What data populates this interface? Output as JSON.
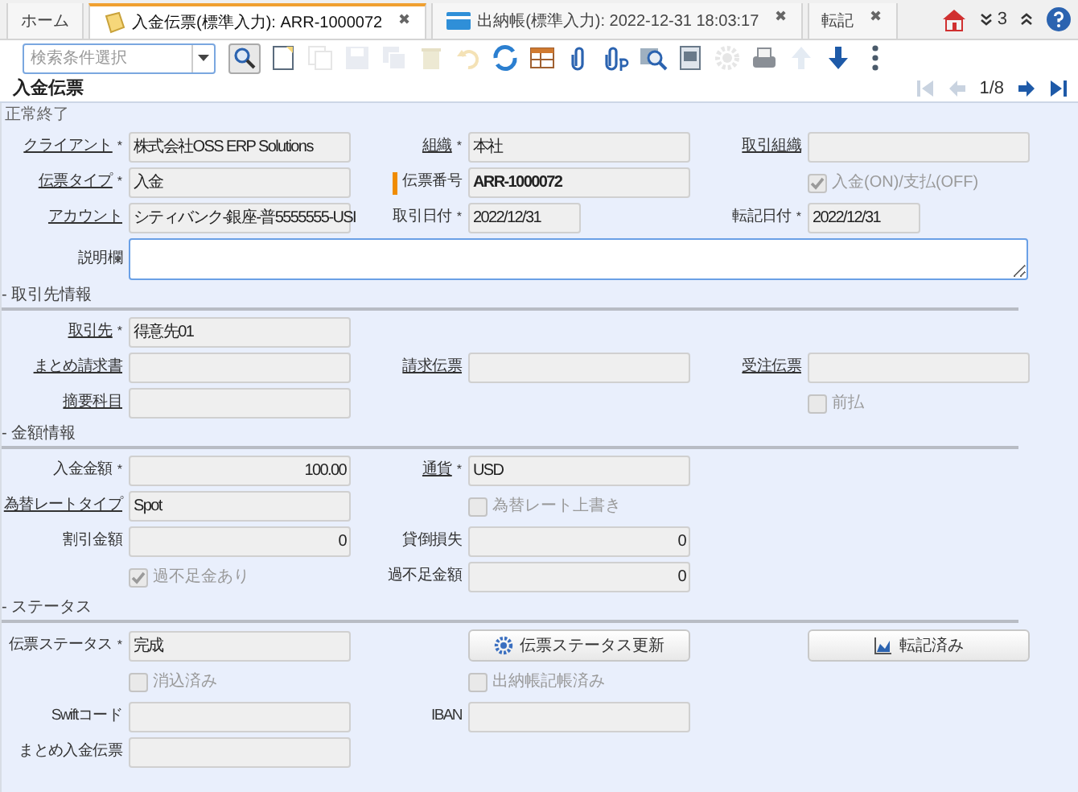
{
  "tabs": [
    {
      "label": "ホーム",
      "selected": false,
      "kind": "home"
    },
    {
      "label": "入金伝票(標準入力): ARR-1000072",
      "selected": true,
      "kind": "note",
      "close": "✖"
    },
    {
      "label": "出納帳(標準入力): 2022-12-31 18:03:17",
      "selected": false,
      "kind": "card",
      "close": "✖"
    },
    {
      "label": "転記",
      "selected": false,
      "kind": "plain",
      "close": "✖"
    }
  ],
  "tab_tools": {
    "count": "3"
  },
  "toolbar": {
    "search": {
      "placeholder": "検索条件選択"
    },
    "buttons": [
      {
        "kind": "find",
        "disabled": false
      },
      {
        "kind": "new",
        "disabled": false
      },
      {
        "kind": "copy",
        "disabled": true
      },
      {
        "kind": "save",
        "disabled": true
      },
      {
        "kind": "saveall",
        "disabled": true
      },
      {
        "kind": "delete",
        "disabled": true
      },
      {
        "kind": "undo",
        "disabled": true
      },
      {
        "kind": "refresh",
        "disabled": false
      },
      {
        "kind": "grid",
        "disabled": false
      },
      {
        "kind": "attach",
        "disabled": false
      },
      {
        "kind": "attachp",
        "disabled": false
      },
      {
        "kind": "zoom",
        "disabled": false
      },
      {
        "kind": "report",
        "disabled": false
      },
      {
        "kind": "gear",
        "disabled": true
      },
      {
        "kind": "print",
        "disabled": false
      },
      {
        "kind": "up",
        "disabled": true
      },
      {
        "kind": "down",
        "disabled": false
      },
      {
        "kind": "more",
        "disabled": false
      }
    ]
  },
  "title": "入金伝票",
  "nav": {
    "position": "1/8",
    "first_disabled": true,
    "prev_disabled": true,
    "next_disabled": false,
    "last_disabled": false
  },
  "status": "正常終了",
  "sections": [
    {
      "rows": [
        [
          {
            "kind": "field",
            "label": "クライアント",
            "link": true,
            "mark": "*",
            "value": "株式会社OSS ERP Solutions"
          },
          {
            "kind": "field",
            "label": "組織",
            "link": true,
            "mark": "*",
            "value": "本社"
          },
          {
            "kind": "field",
            "label": "取引組織",
            "link": true
          }
        ],
        [
          {
            "kind": "field",
            "label": "伝票タイプ",
            "link": true,
            "mark": "*",
            "value": "入金"
          },
          {
            "kind": "field",
            "label": "伝票番号",
            "highlighted": true,
            "value": "ARR-1000072"
          },
          {
            "kind": "checkbox",
            "label": "入金(ON)/支払(OFF)",
            "checked": true
          }
        ],
        [
          {
            "kind": "field",
            "label": "アカウント",
            "link": true,
            "value": "シティバンク-銀座-普5555555-USI"
          },
          {
            "kind": "date",
            "label": "取引日付",
            "mark": "*",
            "value": "2022/12/31"
          },
          {
            "kind": "date",
            "label": "転記日付",
            "mark": "*",
            "value": "2022/12/31"
          }
        ],
        [
          {
            "kind": "textarea",
            "label": "説明欄",
            "focused": true
          }
        ]
      ]
    },
    {
      "header": "- 取引先情報",
      "rows": [
        [
          {
            "kind": "field",
            "label": "取引先",
            "link": true,
            "mark": "*",
            "value": "得意先01"
          },
          {
            "kind": "blank"
          },
          {
            "kind": "blank"
          }
        ],
        [
          {
            "kind": "field",
            "label": "まとめ請求書",
            "link": true
          },
          {
            "kind": "field",
            "label": "請求伝票",
            "link": true
          },
          {
            "kind": "field",
            "label": "受注伝票",
            "link": true
          }
        ],
        [
          {
            "kind": "field",
            "label": "摘要科目",
            "link": true
          },
          {
            "kind": "blank"
          },
          {
            "kind": "checkbox",
            "label": "前払",
            "checked": false
          }
        ]
      ]
    },
    {
      "header": "- 金額情報",
      "rows": [
        [
          {
            "kind": "field",
            "label": "入金金額",
            "mark": "*",
            "value": "100.00",
            "numeric": true
          },
          {
            "kind": "field",
            "label": "通貨",
            "link": true,
            "mark": "*",
            "value": "USD"
          },
          {
            "kind": "blank"
          }
        ],
        [
          {
            "kind": "field",
            "label": "為替レートタイプ",
            "link": true,
            "value": "Spot"
          },
          {
            "kind": "checkbox",
            "label": "為替レート上書き",
            "checked": false
          },
          {
            "kind": "blank"
          }
        ],
        [
          {
            "kind": "field",
            "label": "割引金額",
            "value": "0",
            "numeric": true
          },
          {
            "kind": "field",
            "label": "貸倒損失",
            "value": "0",
            "numeric": true
          },
          {
            "kind": "blank"
          }
        ],
        [
          {
            "kind": "checkbox",
            "label": "過不足金あり",
            "checked": true
          },
          {
            "kind": "field",
            "label": "過不足金額",
            "value": "0",
            "numeric": true
          },
          {
            "kind": "blank"
          }
        ]
      ]
    },
    {
      "header": "- ステータス",
      "rows": [
        [
          {
            "kind": "field",
            "label": "伝票ステータス",
            "mark": "*",
            "value": "完成"
          },
          {
            "kind": "status_button",
            "text": "伝票ステータス更新"
          },
          {
            "kind": "post_button",
            "text": "転記済み"
          }
        ],
        [
          {
            "kind": "checkbox",
            "label": "消込済み",
            "checked": false
          },
          {
            "kind": "checkbox",
            "label": "出納帳記帳済み",
            "checked": false
          },
          {
            "kind": "blank"
          }
        ],
        [
          {
            "kind": "field",
            "label": "Swiftコード"
          },
          {
            "kind": "field",
            "label": "IBAN"
          },
          {
            "kind": "blank"
          }
        ],
        [
          {
            "kind": "field",
            "label": "まとめ入金伝票"
          },
          {
            "kind": "blank"
          },
          {
            "kind": "blank"
          }
        ]
      ]
    }
  ]
}
